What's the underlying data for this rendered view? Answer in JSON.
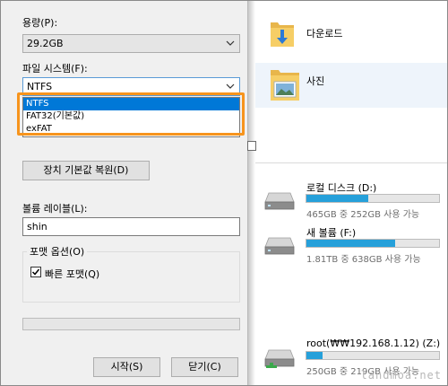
{
  "dialog": {
    "capacity_label": "용량(P):",
    "capacity_value": "29.2GB",
    "filesystem_label": "파일 시스템(F):",
    "filesystem_value": "NTFS",
    "filesystem_options": [
      "NTFS",
      "FAT32(기본값)",
      "exFAT"
    ],
    "restore_defaults_button": "장치 기본값 복원(D)",
    "volume_label_label": "볼륨 레이블(L):",
    "volume_label_value": "shin",
    "format_options_title": "포맷 옵션(O)",
    "quick_format_label": "빠른 포맷(Q)",
    "quick_format_checked": true,
    "start_button": "시작(S)",
    "close_button": "닫기(C)",
    "highlight_color": "#f7941d",
    "selection_color": "#0078d7"
  },
  "explorer": {
    "folders": [
      {
        "name": "다운로드",
        "icon": "download-folder-icon"
      },
      {
        "name": "사진",
        "icon": "pictures-folder-icon"
      }
    ],
    "drives": [
      {
        "name": "로컬 디스크 (D:)",
        "space": "465GB 중 252GB 사용 가능",
        "used_fraction": 0.46,
        "icon": "hard-drive-icon"
      },
      {
        "name": "새 볼륨 (F:)",
        "space": "1.81TB 중 638GB 사용 가능",
        "used_fraction": 0.66,
        "icon": "hard-drive-icon"
      },
      {
        "name": "root(₩₩192.168.1.12) (Z:)",
        "space": "250GB 중 219GB 사용 가능",
        "used_fraction": 0.12,
        "icon": "network-drive-icon"
      }
    ],
    "bar_color": "#26a0da",
    "watermark": "landmoa.net"
  }
}
